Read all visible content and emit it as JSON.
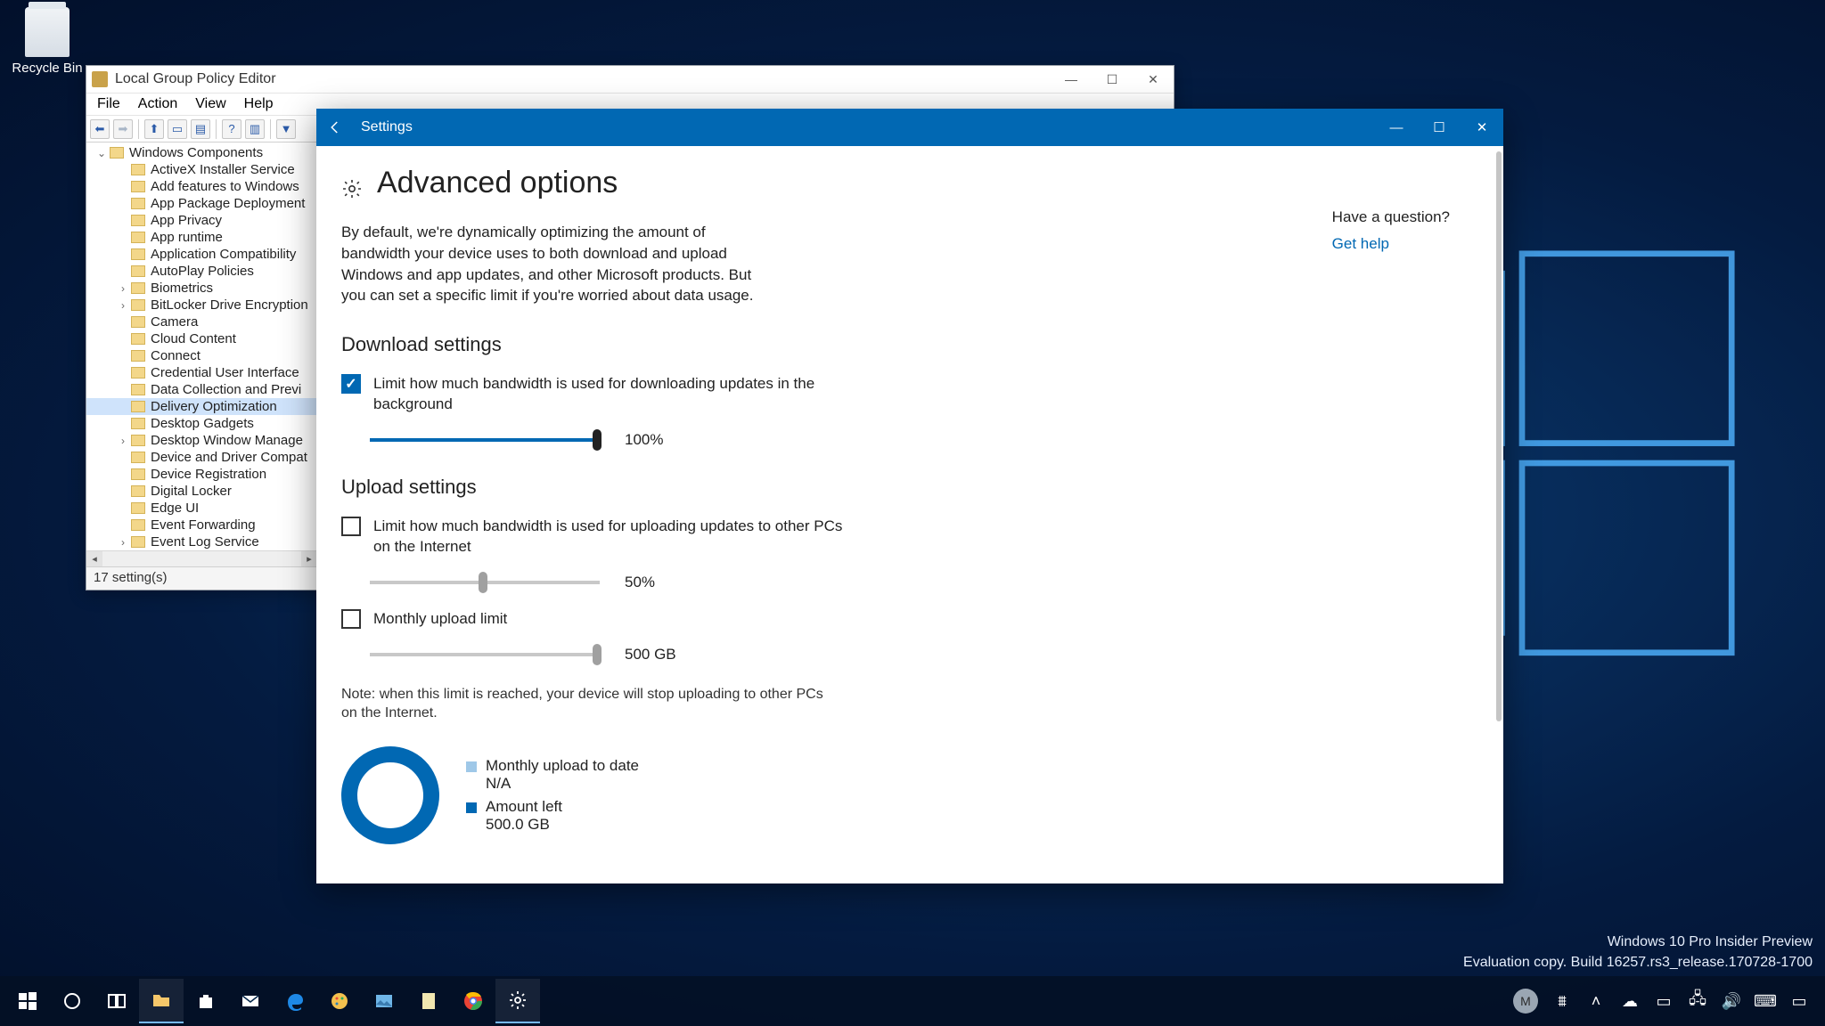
{
  "desktop": {
    "recycle_bin": "Recycle Bin"
  },
  "gpedit": {
    "title": "Local Group Policy Editor",
    "menus": [
      "File",
      "Action",
      "View",
      "Help"
    ],
    "status": "17 setting(s)",
    "tree_root": "Windows Components",
    "tree_items": [
      {
        "label": "ActiveX Installer Service",
        "expandable": false
      },
      {
        "label": "Add features to Windows",
        "expandable": false
      },
      {
        "label": "App Package Deployment",
        "expandable": false
      },
      {
        "label": "App Privacy",
        "expandable": false
      },
      {
        "label": "App runtime",
        "expandable": false
      },
      {
        "label": "Application Compatibility",
        "expandable": false
      },
      {
        "label": "AutoPlay Policies",
        "expandable": false
      },
      {
        "label": "Biometrics",
        "expandable": true
      },
      {
        "label": "BitLocker Drive Encryption",
        "expandable": true
      },
      {
        "label": "Camera",
        "expandable": false
      },
      {
        "label": "Cloud Content",
        "expandable": false
      },
      {
        "label": "Connect",
        "expandable": false
      },
      {
        "label": "Credential User Interface",
        "expandable": false
      },
      {
        "label": "Data Collection and Previ",
        "expandable": false
      },
      {
        "label": "Delivery Optimization",
        "expandable": false,
        "selected": true
      },
      {
        "label": "Desktop Gadgets",
        "expandable": false
      },
      {
        "label": "Desktop Window Manage",
        "expandable": true
      },
      {
        "label": "Device and Driver Compat",
        "expandable": false
      },
      {
        "label": "Device Registration",
        "expandable": false
      },
      {
        "label": "Digital Locker",
        "expandable": false
      },
      {
        "label": "Edge UI",
        "expandable": false
      },
      {
        "label": "Event Forwarding",
        "expandable": false
      },
      {
        "label": "Event Log Service",
        "expandable": true
      }
    ]
  },
  "settings": {
    "window_title": "Settings",
    "page_title": "Advanced options",
    "description": "By default, we're dynamically optimizing the amount of bandwidth your device uses to both download and upload Windows and app updates, and other Microsoft products. But you can set a specific limit if you're worried about data usage.",
    "download_heading": "Download settings",
    "download_check_label": "Limit how much bandwidth is used for downloading updates in the background",
    "download_checked": true,
    "download_percent": "100%",
    "upload_heading": "Upload settings",
    "upload_check_label": "Limit how much bandwidth is used for uploading updates to other PCs on the Internet",
    "upload_checked": false,
    "upload_percent": "50%",
    "monthly_check_label": "Monthly upload limit",
    "monthly_checked": false,
    "monthly_value": "500 GB",
    "note": "Note: when this limit is reached, your device will stop uploading to other PCs on the Internet.",
    "legend_upload_label": "Monthly upload to date",
    "legend_upload_value": "N/A",
    "legend_left_label": "Amount left",
    "legend_left_value": "500.0 GB",
    "help_question": "Have a question?",
    "help_link": "Get help"
  },
  "watermark": {
    "line1": "Windows 10 Pro Insider Preview",
    "line2": "Evaluation copy. Build 16257.rs3_release.170728-1700"
  },
  "taskbar": {
    "avatar_initial": "M"
  }
}
